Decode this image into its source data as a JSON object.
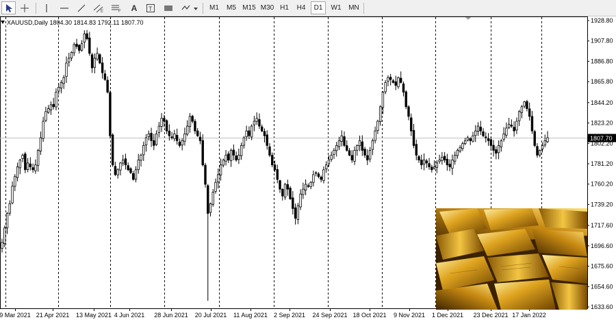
{
  "toolbar": {
    "tools": [
      {
        "name": "cursor-icon"
      },
      {
        "name": "crosshair-icon"
      },
      {
        "name": "vertical-line-icon"
      },
      {
        "name": "horizontal-line-icon"
      },
      {
        "name": "trendline-icon"
      },
      {
        "name": "equidistant-channel-icon"
      },
      {
        "name": "fibonacci-icon"
      },
      {
        "name": "text-tool",
        "label": "A"
      },
      {
        "name": "text-label-icon"
      },
      {
        "name": "rectangle-icon"
      },
      {
        "name": "shapes-dropdown-icon"
      }
    ],
    "timeframes": [
      "M1",
      "M5",
      "M15",
      "M30",
      "H1",
      "H4",
      "D1",
      "W1",
      "MN"
    ],
    "active_timeframe": "D1"
  },
  "chart": {
    "symbol_label": "XAUUSD,Daily  1804.30 1814.83 1792.11 1807.70",
    "current_price_label": "1807.70"
  },
  "chart_data": {
    "type": "candlestick",
    "symbol": "XAUUSD",
    "timeframe": "Daily",
    "ohlc_last": {
      "open": 1804.3,
      "high": 1814.83,
      "low": 1792.11,
      "close": 1807.7
    },
    "current_price": 1807.7,
    "y_ticks": [
      1928.8,
      1907.8,
      1886.8,
      1865.8,
      1844.2,
      1823.2,
      1802.2,
      1781.2,
      1760.2,
      1739.2,
      1717.6,
      1696.6,
      1675.6,
      1654.6,
      1633.6
    ],
    "ylim": [
      1633.6,
      1928.8
    ],
    "x_ticks": [
      "9 Mar 2021",
      "21 Apr 2021",
      "13 May 2021",
      "4 Jun 2021",
      "28 Jun 2021",
      "20 Jul 2021",
      "11 Aug 2021",
      "2 Sep 2021",
      "24 Sep 2021",
      "18 Oct 2021",
      "9 Nov 2021",
      "1 Dec 2021",
      "23 Dec 2021",
      "17 Jan 2022"
    ],
    "close_series_approx": [
      1700,
      1715,
      1730,
      1740,
      1758,
      1768,
      1778,
      1785,
      1790,
      1775,
      1782,
      1778,
      1775,
      1780,
      1795,
      1808,
      1825,
      1835,
      1838,
      1842,
      1840,
      1855,
      1860,
      1865,
      1870,
      1885,
      1890,
      1896,
      1904,
      1902,
      1898,
      1905,
      1915,
      1910,
      1895,
      1880,
      1890,
      1895,
      1885,
      1875,
      1868,
      1855,
      1810,
      1780,
      1770,
      1775,
      1782,
      1785,
      1780,
      1775,
      1772,
      1765,
      1775,
      1785,
      1790,
      1800,
      1808,
      1812,
      1805,
      1800,
      1812,
      1820,
      1828,
      1825,
      1815,
      1810,
      1808,
      1812,
      1805,
      1800,
      1805,
      1812,
      1820,
      1830,
      1825,
      1815,
      1810,
      1805,
      1780,
      1760,
      1730,
      1740,
      1752,
      1762,
      1770,
      1780,
      1785,
      1790,
      1785,
      1795,
      1790,
      1785,
      1790,
      1800,
      1808,
      1815,
      1810,
      1820,
      1825,
      1828,
      1820,
      1815,
      1810,
      1800,
      1790,
      1780,
      1775,
      1765,
      1755,
      1748,
      1760,
      1755,
      1745,
      1735,
      1725,
      1738,
      1750,
      1755,
      1760,
      1758,
      1762,
      1770,
      1772,
      1768,
      1765,
      1775,
      1780,
      1785,
      1790,
      1795,
      1800,
      1805,
      1810,
      1800,
      1795,
      1790,
      1785,
      1795,
      1800,
      1805,
      1795,
      1790,
      1785,
      1795,
      1805,
      1815,
      1825,
      1840,
      1855,
      1865,
      1870,
      1868,
      1865,
      1862,
      1870,
      1865,
      1855,
      1840,
      1830,
      1815,
      1800,
      1790,
      1785,
      1780,
      1785,
      1782,
      1778,
      1775,
      1778,
      1782,
      1785,
      1788,
      1785,
      1780,
      1778,
      1785,
      1790,
      1795,
      1798,
      1802,
      1805,
      1808,
      1805,
      1810,
      1815,
      1820,
      1815,
      1810,
      1808,
      1805,
      1800,
      1795,
      1792,
      1800,
      1805,
      1812,
      1818,
      1822,
      1820,
      1815,
      1825,
      1835,
      1840,
      1845,
      1838,
      1830,
      1815,
      1800,
      1790,
      1795,
      1800,
      1805,
      1808
    ]
  },
  "image": {
    "description_name": "gold-bars-photo"
  }
}
